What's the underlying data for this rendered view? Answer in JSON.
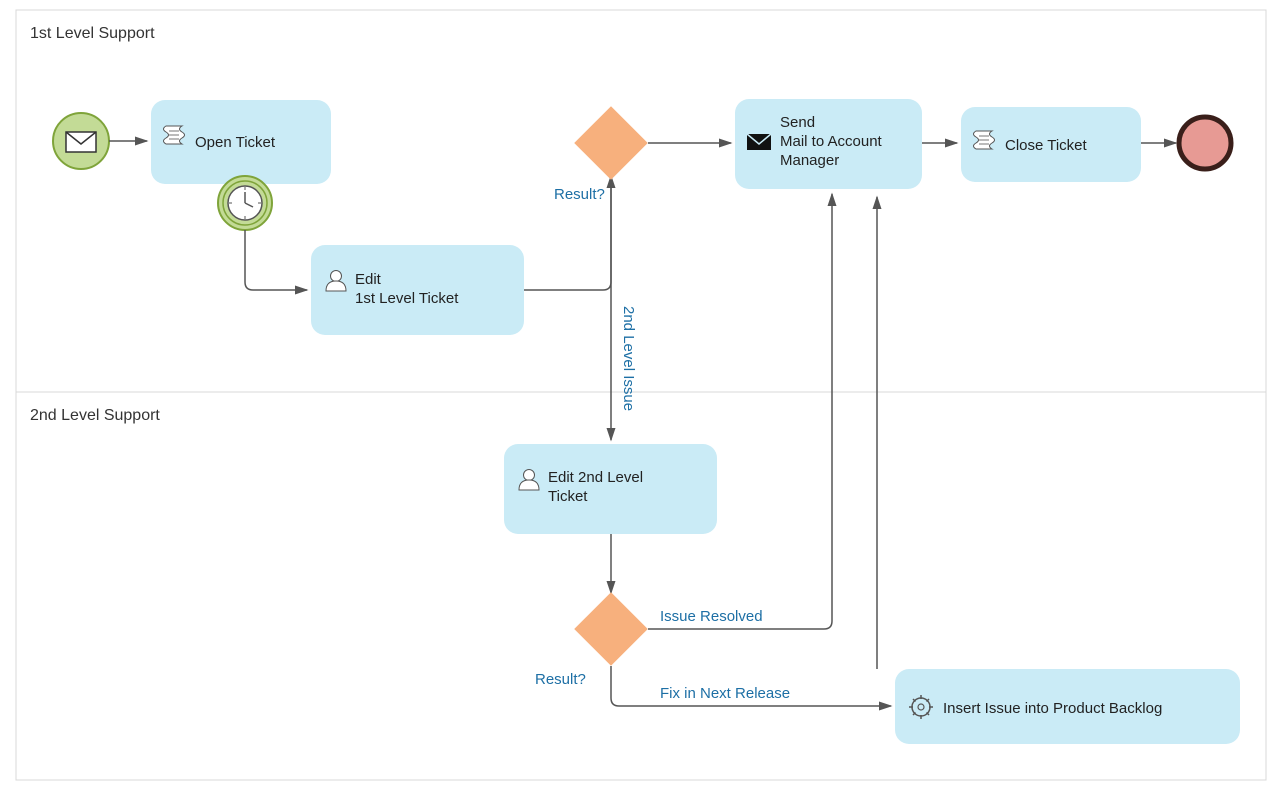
{
  "lanes": {
    "l1": "1st Level Support",
    "l2": "2nd Level Support"
  },
  "tasks": {
    "openTicket": "Open Ticket",
    "edit1_line1": "Edit",
    "edit1_line2": "1st Level Ticket",
    "sendMail_line1": "Send",
    "sendMail_line2": "Mail to Account",
    "sendMail_line3": "Manager",
    "closeTicket": "Close Ticket",
    "edit2_line1": "Edit 2nd Level",
    "edit2_line2": "Ticket",
    "insertBacklog": "Insert Issue into Product Backlog"
  },
  "labels": {
    "result1": "Result?",
    "result2": "Result?",
    "secondLevel": "2nd Level Issue",
    "issueResolved": "Issue Resolved",
    "fixNext": "Fix in Next Release"
  },
  "colors": {
    "taskFill": "#caebf6",
    "gatewayFill": "#f7b07d",
    "startFill": "#c3db96",
    "labelColor": "#1d6fa5"
  }
}
